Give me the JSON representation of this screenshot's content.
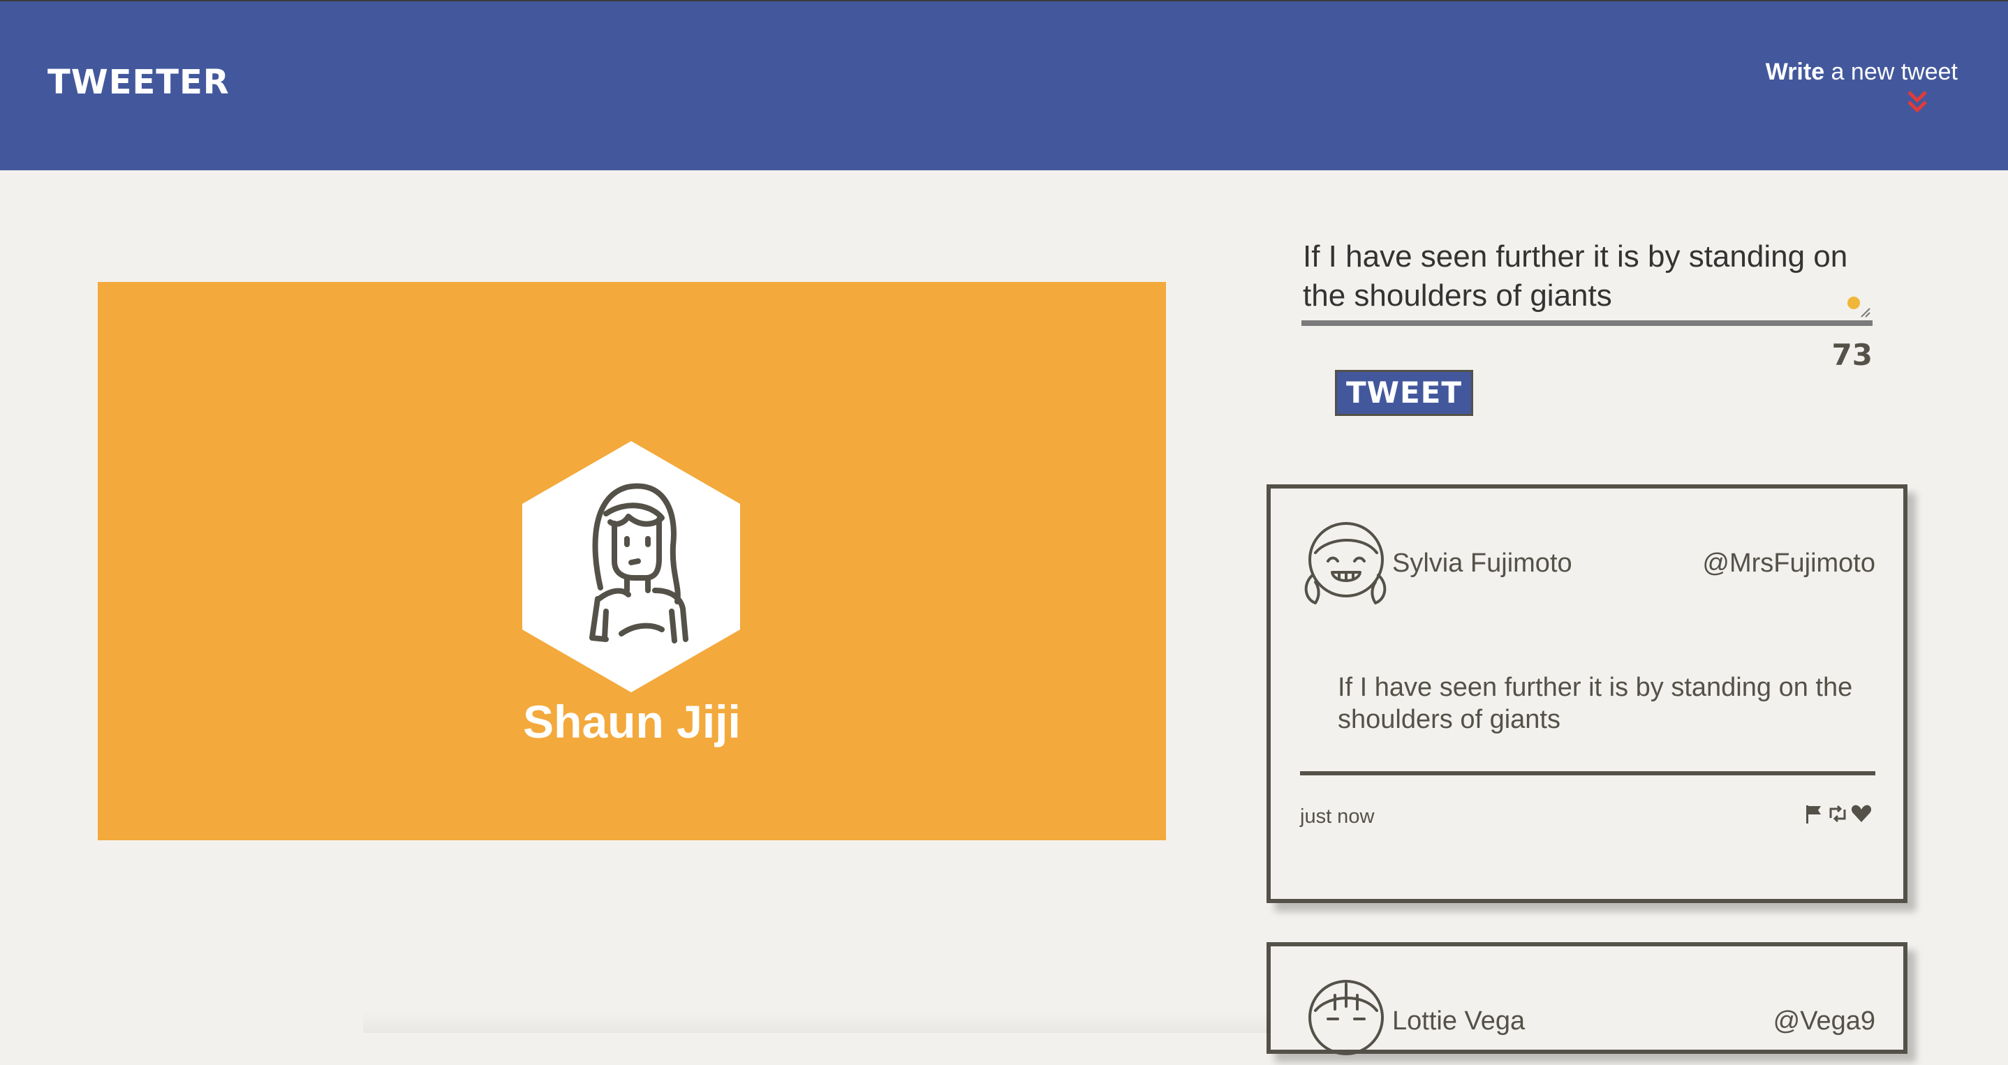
{
  "nav": {
    "brand": "Tweeter",
    "compose_strong": "Write",
    "compose_rest": " a new tweet",
    "chevron_color": "#e03b3b"
  },
  "profile": {
    "name": "Shaun Jiji",
    "banner_color": "#f3a93c",
    "avatar_icon": "user-avatar-icon"
  },
  "compose": {
    "text": "If I have seen further it is by standing on the shoulders of giants",
    "counter": "73",
    "button_label": "Tweet"
  },
  "tweets": [
    {
      "author": "Sylvia Fujimoto",
      "handle": "@MrsFujimoto",
      "content": "If I have seen further it is by standing on the shoulders of giants",
      "timestamp": "just now",
      "avatar_icon": "girl-with-pigtails-icon",
      "actions": [
        "flag-icon",
        "retweet-icon",
        "heart-icon"
      ]
    },
    {
      "author": "Lottie Vega",
      "handle": "@Vega9",
      "avatar_icon": "girl-avatar-icon"
    }
  ],
  "colors": {
    "nav_bg": "#43589c",
    "page_bg": "#f3f1ed",
    "text_dark": "#545149",
    "accent_dot": "#f0b63a"
  }
}
